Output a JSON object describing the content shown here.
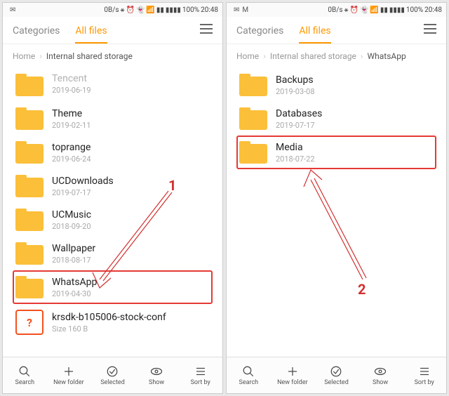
{
  "status": {
    "speed": "0B/s",
    "battery": "100%",
    "time": "20:48"
  },
  "tabs": {
    "categories": "Categories",
    "all_files": "All files"
  },
  "left": {
    "breadcrumb": [
      "Home",
      "Internal shared storage"
    ],
    "items": [
      {
        "name": "Tencent",
        "date": "2019-06-19",
        "type": "folder",
        "cut": true
      },
      {
        "name": "Theme",
        "date": "2019-02-11",
        "type": "folder"
      },
      {
        "name": "toprange",
        "date": "2019-06-24",
        "type": "folder"
      },
      {
        "name": "UCDownloads",
        "date": "2019-07-17",
        "type": "folder"
      },
      {
        "name": "UCMusic",
        "date": "2018-09-20",
        "type": "folder"
      },
      {
        "name": "Wallpaper",
        "date": "2018-08-17",
        "type": "folder"
      },
      {
        "name": "WhatsApp",
        "date": "2019-04-30",
        "type": "folder",
        "highlight": true
      },
      {
        "name": "krsdk-b105006-stock-conf",
        "date": "Size 160 B",
        "type": "file"
      }
    ]
  },
  "right": {
    "breadcrumb": [
      "Home",
      "Internal shared storage",
      "WhatsApp"
    ],
    "items": [
      {
        "name": "Backups",
        "date": "2019-03-08",
        "type": "folder"
      },
      {
        "name": "Databases",
        "date": "2019-07-17",
        "type": "folder"
      },
      {
        "name": "Media",
        "date": "2018-07-22",
        "type": "folder",
        "highlight": true
      }
    ]
  },
  "bottom": [
    "Search",
    "New folder",
    "Selected",
    "Show",
    "Sort by"
  ],
  "annotations": {
    "one": "1",
    "two": "2"
  }
}
